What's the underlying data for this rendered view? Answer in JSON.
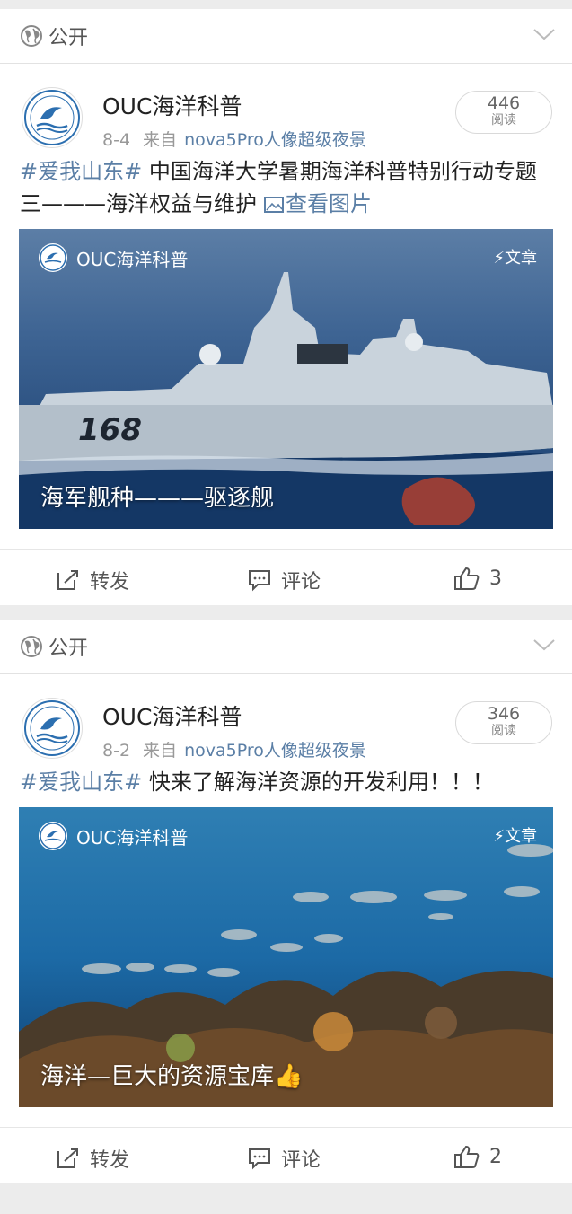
{
  "posts": [
    {
      "visibility": "公开",
      "author": "OUC海洋科普",
      "date": "8-4",
      "from_label": "来自",
      "source": "nova5Pro人像超级夜景",
      "reads_count": "446",
      "reads_label": "阅读",
      "hashtag": "#爱我山东#",
      "text": " 中国海洋大学暑期海洋科普特别行动专题三———海洋权益与维护",
      "view_images": "查看图片",
      "card": {
        "brand": "OUC海洋科普",
        "badge": "文章",
        "caption": "海军舰种———驱逐舰",
        "hull_number": "168"
      },
      "repost_label": "转发",
      "comment_label": "评论",
      "like_count": "3"
    },
    {
      "visibility": "公开",
      "author": "OUC海洋科普",
      "date": "8-2",
      "from_label": "来自",
      "source": "nova5Pro人像超级夜景",
      "reads_count": "346",
      "reads_label": "阅读",
      "hashtag": "#爱我山东#",
      "text": " 快来了解海洋资源的开发利用！！！",
      "card": {
        "brand": "OUC海洋科普",
        "badge": "文章",
        "caption": "海洋—巨大的资源宝库👍"
      },
      "repost_label": "转发",
      "comment_label": "评论",
      "like_count": "2"
    }
  ],
  "colors": {
    "link": "#5b7fa6",
    "background": "#ececec",
    "meta": "#999999"
  }
}
